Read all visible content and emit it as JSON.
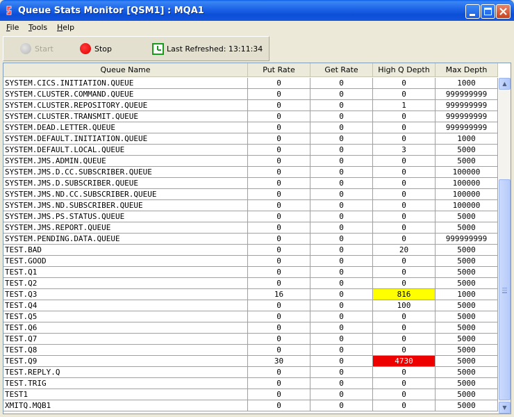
{
  "window": {
    "title": "Queue Stats Monitor [QSM1] : MQA1"
  },
  "menu": [
    {
      "label": "File",
      "accel": "F",
      "rest": "ile"
    },
    {
      "label": "Tools",
      "accel": "T",
      "rest": "ools"
    },
    {
      "label": "Help",
      "accel": "H",
      "rest": "elp"
    }
  ],
  "toolbar": {
    "start_label": "Start",
    "stop_label": "Stop",
    "refresh_label": "Last Refreshed: 13:11:34"
  },
  "table": {
    "columns": [
      "Queue Name",
      "Put Rate",
      "Get Rate",
      "High Q Depth",
      "Max Depth"
    ],
    "rows": [
      [
        "SYSTEM.CICS.INITIATION.QUEUE",
        "0",
        "0",
        "0",
        "1000"
      ],
      [
        "SYSTEM.CLUSTER.COMMAND.QUEUE",
        "0",
        "0",
        "0",
        "999999999"
      ],
      [
        "SYSTEM.CLUSTER.REPOSITORY.QUEUE",
        "0",
        "0",
        "1",
        "999999999"
      ],
      [
        "SYSTEM.CLUSTER.TRANSMIT.QUEUE",
        "0",
        "0",
        "0",
        "999999999"
      ],
      [
        "SYSTEM.DEAD.LETTER.QUEUE",
        "0",
        "0",
        "0",
        "999999999"
      ],
      [
        "SYSTEM.DEFAULT.INITIATION.QUEUE",
        "0",
        "0",
        "0",
        "1000"
      ],
      [
        "SYSTEM.DEFAULT.LOCAL.QUEUE",
        "0",
        "0",
        "3",
        "5000"
      ],
      [
        "SYSTEM.JMS.ADMIN.QUEUE",
        "0",
        "0",
        "0",
        "5000"
      ],
      [
        "SYSTEM.JMS.D.CC.SUBSCRIBER.QUEUE",
        "0",
        "0",
        "0",
        "100000"
      ],
      [
        "SYSTEM.JMS.D.SUBSCRIBER.QUEUE",
        "0",
        "0",
        "0",
        "100000"
      ],
      [
        "SYSTEM.JMS.ND.CC.SUBSCRIBER.QUEUE",
        "0",
        "0",
        "0",
        "100000"
      ],
      [
        "SYSTEM.JMS.ND.SUBSCRIBER.QUEUE",
        "0",
        "0",
        "0",
        "100000"
      ],
      [
        "SYSTEM.JMS.PS.STATUS.QUEUE",
        "0",
        "0",
        "0",
        "5000"
      ],
      [
        "SYSTEM.JMS.REPORT.QUEUE",
        "0",
        "0",
        "0",
        "5000"
      ],
      [
        "SYSTEM.PENDING.DATA.QUEUE",
        "0",
        "0",
        "0",
        "999999999"
      ],
      [
        "TEST.BAD",
        "0",
        "0",
        "20",
        "5000"
      ],
      [
        "TEST.GOOD",
        "0",
        "0",
        "0",
        "5000"
      ],
      [
        "TEST.Q1",
        "0",
        "0",
        "0",
        "5000"
      ],
      [
        "TEST.Q2",
        "0",
        "0",
        "0",
        "5000"
      ],
      [
        "TEST.Q3",
        "16",
        "0",
        "816",
        "1000"
      ],
      [
        "TEST.Q4",
        "0",
        "0",
        "100",
        "5000"
      ],
      [
        "TEST.Q5",
        "0",
        "0",
        "0",
        "5000"
      ],
      [
        "TEST.Q6",
        "0",
        "0",
        "0",
        "5000"
      ],
      [
        "TEST.Q7",
        "0",
        "0",
        "0",
        "5000"
      ],
      [
        "TEST.Q8",
        "0",
        "0",
        "0",
        "5000"
      ],
      [
        "TEST.Q9",
        "30",
        "0",
        "4730",
        "5000"
      ],
      [
        "TEST.REPLY.Q",
        "0",
        "0",
        "0",
        "5000"
      ],
      [
        "TEST.TRIG",
        "0",
        "0",
        "0",
        "5000"
      ],
      [
        "TEST1",
        "0",
        "0",
        "0",
        "5000"
      ],
      [
        "XMITQ.MQB1",
        "0",
        "0",
        "0",
        "5000"
      ]
    ],
    "highlights": [
      {
        "row": 19,
        "col": 3,
        "color": "#ffff00",
        "level": "warning"
      },
      {
        "row": 25,
        "col": 3,
        "color": "#ee0000",
        "level": "critical"
      }
    ]
  }
}
